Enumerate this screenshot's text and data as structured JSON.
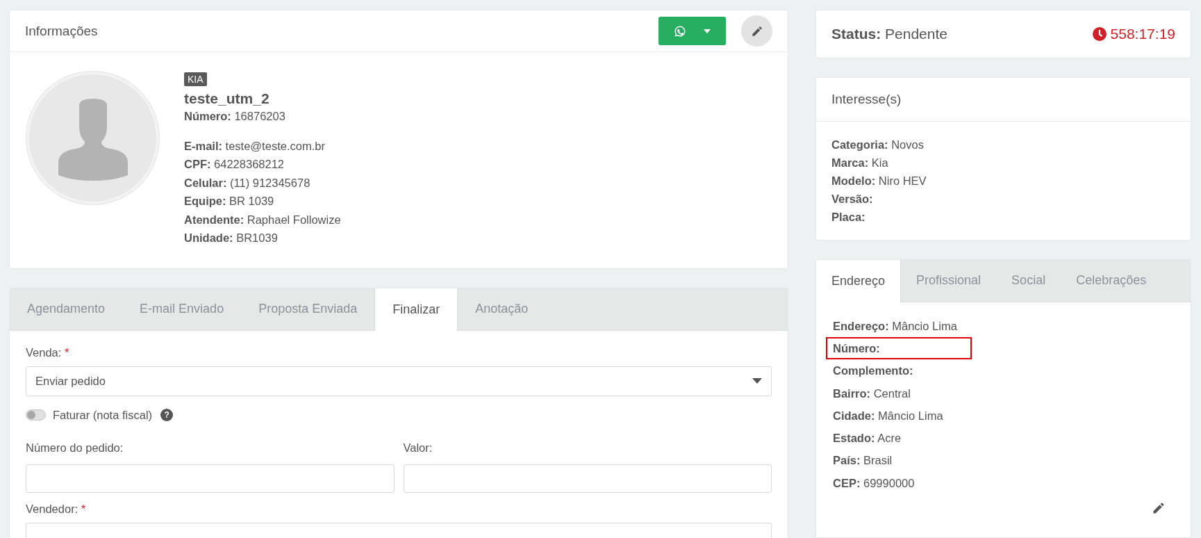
{
  "info": {
    "title": "Informações",
    "badge": "KIA",
    "name": "teste_utm_2",
    "number": {
      "label": "Número:",
      "value": "16876203"
    },
    "fields": [
      {
        "label": "E-mail:",
        "value": "teste@teste.com.br"
      },
      {
        "label": "CPF:",
        "value": "64228368212"
      },
      {
        "label": "Celular:",
        "value": "(11) 912345678"
      },
      {
        "label": "Equipe:",
        "value": "BR 1039"
      },
      {
        "label": "Atendente:",
        "value": "Raphael Followize"
      },
      {
        "label": "Unidade:",
        "value": "BR1039"
      }
    ]
  },
  "tabs": [
    {
      "label": "Agendamento",
      "selected": false
    },
    {
      "label": "E-mail Enviado",
      "selected": false
    },
    {
      "label": "Proposta Enviada",
      "selected": false
    },
    {
      "label": "Finalizar",
      "selected": true
    },
    {
      "label": "Anotação",
      "selected": false
    }
  ],
  "form": {
    "sale": {
      "label": "Venda:",
      "required": "*",
      "value": "Enviar pedido"
    },
    "invoice": {
      "label": "Faturar (nota fiscal)",
      "on": false,
      "help": "?"
    },
    "order_number": {
      "label": "Número do pedido:"
    },
    "amount": {
      "label": "Valor:"
    },
    "seller": {
      "label": "Vendedor:",
      "required": "*"
    }
  },
  "status": {
    "label": "Status:",
    "value": "Pendente",
    "timer": "558:17:19"
  },
  "interest": {
    "title": "Interesse(s)",
    "fields": [
      {
        "label": "Categoria:",
        "value": "Novos"
      },
      {
        "label": "Marca:",
        "value": "Kia"
      },
      {
        "label": "Modelo:",
        "value": "Niro HEV"
      },
      {
        "label": "Versão:"
      },
      {
        "label": "Placa:"
      }
    ]
  },
  "contact_tabs": [
    {
      "label": "Endereço",
      "selected": true
    },
    {
      "label": "Profissional",
      "selected": false
    },
    {
      "label": "Social",
      "selected": false
    },
    {
      "label": "Celebrações",
      "selected": false
    }
  ],
  "address": [
    {
      "label": "Endereço:",
      "value": "Mâncio Lima",
      "highlighted": false
    },
    {
      "label": "Número:",
      "highlighted": true
    },
    {
      "label": "Complemento:",
      "highlighted": false
    },
    {
      "label": "Bairro:",
      "value": "Central",
      "highlighted": false
    },
    {
      "label": "Cidade:",
      "value": "Mâncio Lima",
      "highlighted": false
    },
    {
      "label": "Estado:",
      "value": "Acre",
      "highlighted": false
    },
    {
      "label": "País:",
      "value": "Brasil",
      "highlighted": false
    },
    {
      "label": "CEP:",
      "value": "69990000",
      "highlighted": false
    }
  ]
}
